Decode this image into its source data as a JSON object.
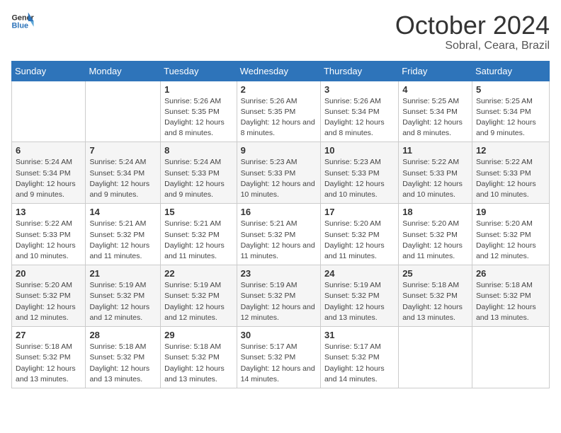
{
  "logo": {
    "line1": "General",
    "line2": "Blue"
  },
  "title": "October 2024",
  "subtitle": "Sobral, Ceara, Brazil",
  "header_days": [
    "Sunday",
    "Monday",
    "Tuesday",
    "Wednesday",
    "Thursday",
    "Friday",
    "Saturday"
  ],
  "weeks": [
    [
      {
        "day": "",
        "info": ""
      },
      {
        "day": "",
        "info": ""
      },
      {
        "day": "1",
        "info": "Sunrise: 5:26 AM\nSunset: 5:35 PM\nDaylight: 12 hours and 8 minutes."
      },
      {
        "day": "2",
        "info": "Sunrise: 5:26 AM\nSunset: 5:35 PM\nDaylight: 12 hours and 8 minutes."
      },
      {
        "day": "3",
        "info": "Sunrise: 5:26 AM\nSunset: 5:34 PM\nDaylight: 12 hours and 8 minutes."
      },
      {
        "day": "4",
        "info": "Sunrise: 5:25 AM\nSunset: 5:34 PM\nDaylight: 12 hours and 8 minutes."
      },
      {
        "day": "5",
        "info": "Sunrise: 5:25 AM\nSunset: 5:34 PM\nDaylight: 12 hours and 9 minutes."
      }
    ],
    [
      {
        "day": "6",
        "info": "Sunrise: 5:24 AM\nSunset: 5:34 PM\nDaylight: 12 hours and 9 minutes."
      },
      {
        "day": "7",
        "info": "Sunrise: 5:24 AM\nSunset: 5:34 PM\nDaylight: 12 hours and 9 minutes."
      },
      {
        "day": "8",
        "info": "Sunrise: 5:24 AM\nSunset: 5:33 PM\nDaylight: 12 hours and 9 minutes."
      },
      {
        "day": "9",
        "info": "Sunrise: 5:23 AM\nSunset: 5:33 PM\nDaylight: 12 hours and 10 minutes."
      },
      {
        "day": "10",
        "info": "Sunrise: 5:23 AM\nSunset: 5:33 PM\nDaylight: 12 hours and 10 minutes."
      },
      {
        "day": "11",
        "info": "Sunrise: 5:22 AM\nSunset: 5:33 PM\nDaylight: 12 hours and 10 minutes."
      },
      {
        "day": "12",
        "info": "Sunrise: 5:22 AM\nSunset: 5:33 PM\nDaylight: 12 hours and 10 minutes."
      }
    ],
    [
      {
        "day": "13",
        "info": "Sunrise: 5:22 AM\nSunset: 5:33 PM\nDaylight: 12 hours and 10 minutes."
      },
      {
        "day": "14",
        "info": "Sunrise: 5:21 AM\nSunset: 5:32 PM\nDaylight: 12 hours and 11 minutes."
      },
      {
        "day": "15",
        "info": "Sunrise: 5:21 AM\nSunset: 5:32 PM\nDaylight: 12 hours and 11 minutes."
      },
      {
        "day": "16",
        "info": "Sunrise: 5:21 AM\nSunset: 5:32 PM\nDaylight: 12 hours and 11 minutes."
      },
      {
        "day": "17",
        "info": "Sunrise: 5:20 AM\nSunset: 5:32 PM\nDaylight: 12 hours and 11 minutes."
      },
      {
        "day": "18",
        "info": "Sunrise: 5:20 AM\nSunset: 5:32 PM\nDaylight: 12 hours and 11 minutes."
      },
      {
        "day": "19",
        "info": "Sunrise: 5:20 AM\nSunset: 5:32 PM\nDaylight: 12 hours and 12 minutes."
      }
    ],
    [
      {
        "day": "20",
        "info": "Sunrise: 5:20 AM\nSunset: 5:32 PM\nDaylight: 12 hours and 12 minutes."
      },
      {
        "day": "21",
        "info": "Sunrise: 5:19 AM\nSunset: 5:32 PM\nDaylight: 12 hours and 12 minutes."
      },
      {
        "day": "22",
        "info": "Sunrise: 5:19 AM\nSunset: 5:32 PM\nDaylight: 12 hours and 12 minutes."
      },
      {
        "day": "23",
        "info": "Sunrise: 5:19 AM\nSunset: 5:32 PM\nDaylight: 12 hours and 12 minutes."
      },
      {
        "day": "24",
        "info": "Sunrise: 5:19 AM\nSunset: 5:32 PM\nDaylight: 12 hours and 13 minutes."
      },
      {
        "day": "25",
        "info": "Sunrise: 5:18 AM\nSunset: 5:32 PM\nDaylight: 12 hours and 13 minutes."
      },
      {
        "day": "26",
        "info": "Sunrise: 5:18 AM\nSunset: 5:32 PM\nDaylight: 12 hours and 13 minutes."
      }
    ],
    [
      {
        "day": "27",
        "info": "Sunrise: 5:18 AM\nSunset: 5:32 PM\nDaylight: 12 hours and 13 minutes."
      },
      {
        "day": "28",
        "info": "Sunrise: 5:18 AM\nSunset: 5:32 PM\nDaylight: 12 hours and 13 minutes."
      },
      {
        "day": "29",
        "info": "Sunrise: 5:18 AM\nSunset: 5:32 PM\nDaylight: 12 hours and 13 minutes."
      },
      {
        "day": "30",
        "info": "Sunrise: 5:17 AM\nSunset: 5:32 PM\nDaylight: 12 hours and 14 minutes."
      },
      {
        "day": "31",
        "info": "Sunrise: 5:17 AM\nSunset: 5:32 PM\nDaylight: 12 hours and 14 minutes."
      },
      {
        "day": "",
        "info": ""
      },
      {
        "day": "",
        "info": ""
      }
    ]
  ]
}
